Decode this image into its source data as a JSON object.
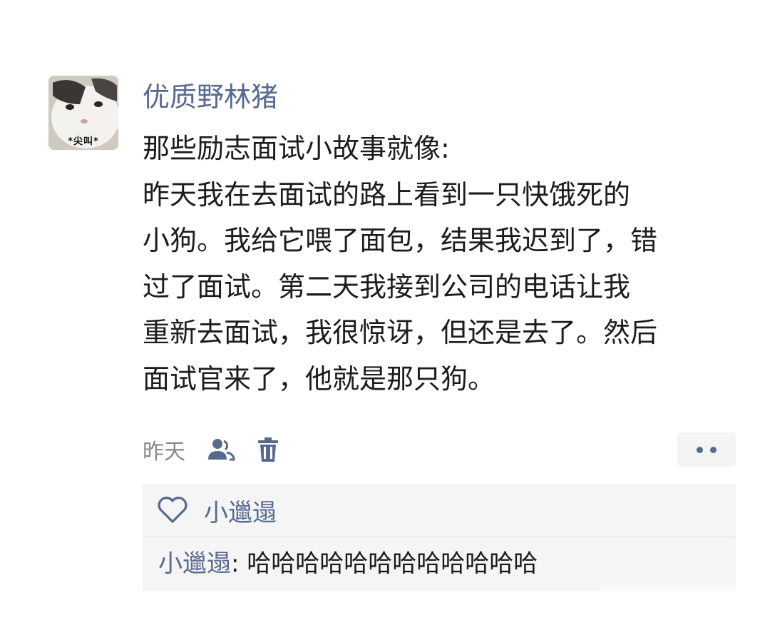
{
  "post": {
    "avatar_caption": "*尖叫*",
    "username": "优质野林猪",
    "body_lines": [
      "那些励志面试小故事就像:",
      "昨天我在去面试的路上看到一只快饿死的",
      "小狗。我给它喂了面包，结果我迟到了，错",
      "过了面试。第二天我接到公司的电话让我",
      "重新去面试，我很惊讶，但还是去了。然后",
      "面试官来了，他就是那只狗。"
    ],
    "time": "昨天"
  },
  "icons": {
    "visibility": "friends-visibility-icon",
    "delete": "trash-icon",
    "more": "more-dots-icon",
    "like": "heart-outline-icon"
  },
  "likes": {
    "names": "小邋遢"
  },
  "comment": {
    "author": "小邋遢",
    "separator": ": ",
    "text": "哈哈哈哈哈哈哈哈哈哈哈哈"
  },
  "colors": {
    "link": "#56698f",
    "comment_bg": "#f5f5f5",
    "meta": "#8a8a8a"
  }
}
